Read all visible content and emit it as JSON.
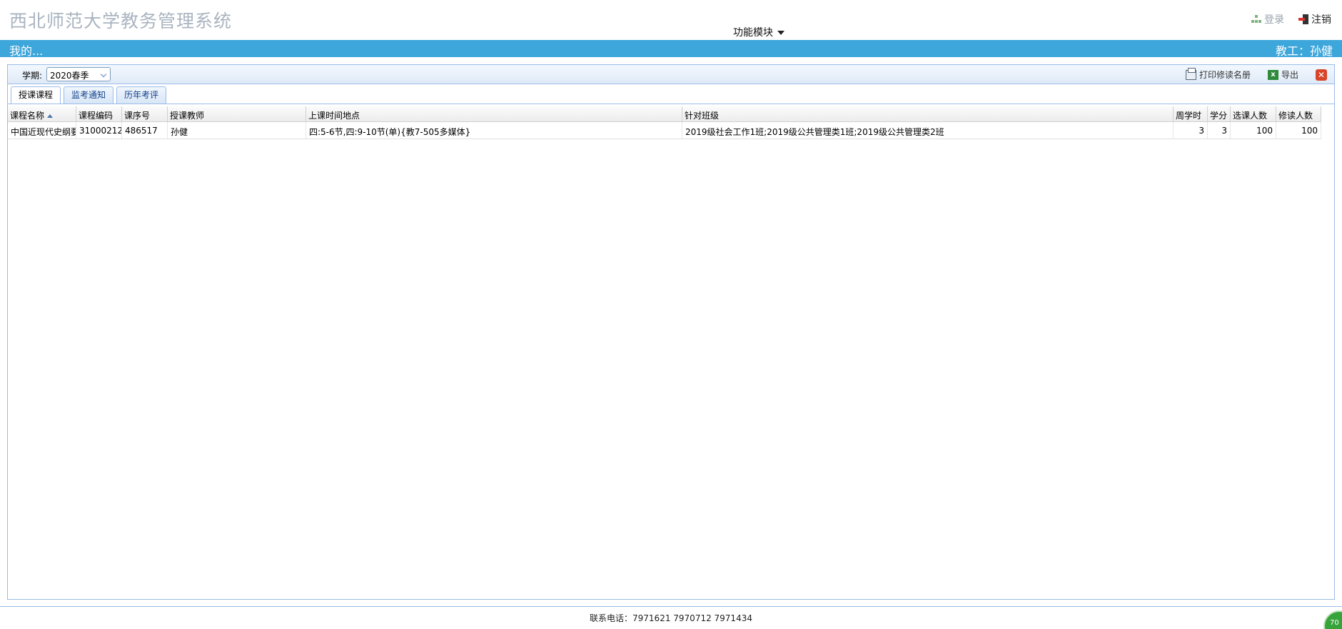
{
  "header": {
    "title": "西北师范大学教务管理系统",
    "func_menu": "功能模块",
    "login": "登录",
    "logout": "注销"
  },
  "bluebar": {
    "left": "我的...",
    "right": "教工：孙健"
  },
  "toolbar": {
    "term_label": "学期:",
    "term_value": "2020春季",
    "print_label": "打印修读名册",
    "export_label": "导出"
  },
  "tabs": [
    {
      "label": "授课课程",
      "active": true
    },
    {
      "label": "监考通知",
      "active": false
    },
    {
      "label": "历年考评",
      "active": false
    }
  ],
  "table": {
    "columns": [
      "课程名称",
      "课程编码",
      "课序号",
      "授课教师",
      "上课时间地点",
      "针对班级",
      "周学时",
      "学分",
      "选课人数",
      "修读人数"
    ],
    "rows": [
      [
        "中国近现代史纲要",
        "31000212",
        "486517",
        "孙健",
        "四:5-6节,四:9-10节(单){教7-505多媒体}",
        "2019级社会工作1班;2019级公共管理类1班;2019级公共管理类2班",
        "3",
        "3",
        "100",
        "100"
      ]
    ]
  },
  "footer": {
    "contact": "联系电话：7971621 7970712 7971434",
    "badge": "70"
  },
  "colors": {
    "accent": "#3da6da",
    "border": "#99bbe8"
  }
}
